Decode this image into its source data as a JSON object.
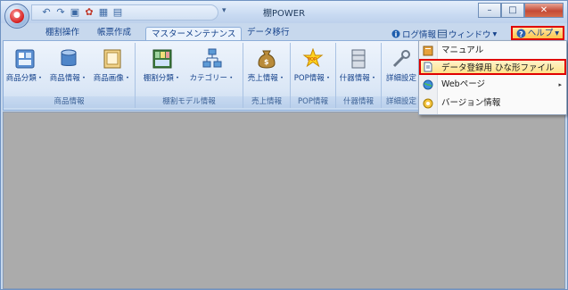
{
  "window": {
    "title": "棚POWER"
  },
  "quick_access": {
    "icons": [
      "undo-icon",
      "redo-icon",
      "save-icon",
      "shelf-icon",
      "tile-icon",
      "window-icon"
    ],
    "dropdown": "▾"
  },
  "window_buttons": {
    "minimize": "–",
    "maximize": "□",
    "close": "✕"
  },
  "tabs": [
    {
      "label": "棚割操作"
    },
    {
      "label": "帳票作成"
    },
    {
      "label": "マスターメンテナンス"
    },
    {
      "label": "データ移行"
    }
  ],
  "right_menus": {
    "log": "ログ情報",
    "window": "ウィンドウ",
    "help": "ヘルプ",
    "dropdown": "▾"
  },
  "ribbon": {
    "groups": [
      {
        "label": "商品情報",
        "buttons": [
          "商品分類・",
          "商品情報・",
          "商品画像・"
        ]
      },
      {
        "label": "棚割モデル情報",
        "buttons": [
          "棚割分類・",
          "カテゴリー・"
        ]
      },
      {
        "label": "売上情報",
        "buttons": [
          "売上情報・"
        ]
      },
      {
        "label": "POP情報",
        "buttons": [
          "POP情報・"
        ]
      },
      {
        "label": "什器情報",
        "buttons": [
          "什器情報・"
        ]
      },
      {
        "label": "詳細設定",
        "buttons": [
          "詳細設定"
        ]
      }
    ]
  },
  "help_menu": {
    "items": [
      {
        "label": "マニュアル"
      },
      {
        "label": "データ登録用 ひな形ファイル"
      },
      {
        "label": "Webページ"
      },
      {
        "label": "バージョン情報"
      }
    ],
    "submenu_arrow": "▸"
  },
  "colors": {
    "highlight_border": "#e00000",
    "content_bg": "#ababab"
  }
}
